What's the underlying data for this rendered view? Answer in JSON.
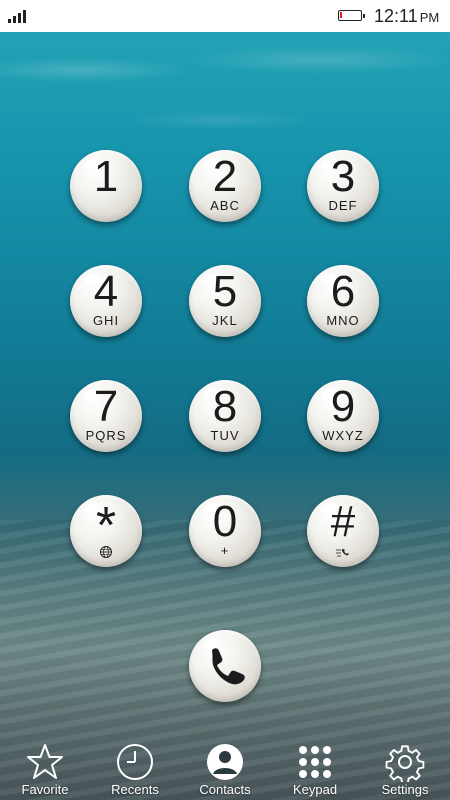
{
  "status_bar": {
    "time": "12:11",
    "ampm": "PM",
    "battery_level": 0.1,
    "battery_color": "#e02020"
  },
  "keypad": {
    "keys": [
      {
        "digit": "1",
        "letters": ""
      },
      {
        "digit": "2",
        "letters": "ABC"
      },
      {
        "digit": "3",
        "letters": "DEF"
      },
      {
        "digit": "4",
        "letters": "GHI"
      },
      {
        "digit": "5",
        "letters": "JKL"
      },
      {
        "digit": "6",
        "letters": "MNO"
      },
      {
        "digit": "7",
        "letters": "PQRS"
      },
      {
        "digit": "8",
        "letters": "TUV"
      },
      {
        "digit": "9",
        "letters": "WXYZ"
      },
      {
        "digit": "*",
        "sub_icon": "globe-icon"
      },
      {
        "digit": "0",
        "letters": "+"
      },
      {
        "digit": "#",
        "sub_icon": "speed-dial-icon"
      }
    ],
    "call_icon": "phone-icon"
  },
  "nav": {
    "items": [
      {
        "label": "Favorite",
        "icon": "star-icon"
      },
      {
        "label": "Recents",
        "icon": "clock-icon"
      },
      {
        "label": "Contacts",
        "icon": "contact-icon"
      },
      {
        "label": "Keypad",
        "icon": "keypad-grid-icon"
      },
      {
        "label": "Settings",
        "icon": "gear-icon"
      }
    ]
  }
}
